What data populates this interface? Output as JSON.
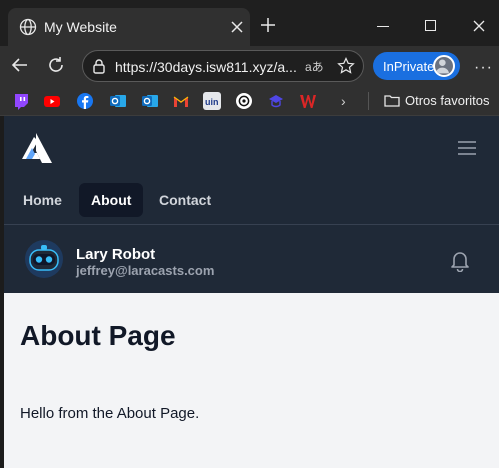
{
  "browser": {
    "tab_title": "My Website",
    "url": "https://30days.isw811.xyz/a...",
    "read_aloud_glyph": "aあ",
    "inprivate_label": "InPrivate",
    "more_menu": "···",
    "favorites_chevron": "›",
    "other_favorites": "Otros favoritos",
    "favorites": [
      {
        "name": "twitch-icon",
        "color": "#9146ff"
      },
      {
        "name": "youtube-icon",
        "color": "#ff0000"
      },
      {
        "name": "facebook-icon",
        "color": "#1877f2"
      },
      {
        "name": "outlook-icon",
        "color": "#0f6cbd"
      },
      {
        "name": "outlook-icon-2",
        "color": "#0f6cbd"
      },
      {
        "name": "gmail-icon",
        "color": "#ea4335"
      },
      {
        "name": "uin-icon",
        "color": "#e5e7eb"
      },
      {
        "name": "openai-icon",
        "color": "#ffffff"
      },
      {
        "name": "grader-icon",
        "color": "#4f46e5"
      },
      {
        "name": "w-icon",
        "color": "#dc2626"
      }
    ]
  },
  "site": {
    "nav": {
      "links": [
        {
          "label": "Home",
          "active": false
        },
        {
          "label": "About",
          "active": true
        },
        {
          "label": "Contact",
          "active": false
        }
      ]
    },
    "user": {
      "name": "Lary Robot",
      "email": "jeffrey@laracasts.com"
    },
    "page": {
      "title": "About Page",
      "body": "Hello from the About Page."
    }
  },
  "colors": {
    "nav_background": "#1f2937",
    "active_link_background": "#111827",
    "page_background": "#f3f4f6",
    "inprivate_blue": "#1a6fe0"
  }
}
